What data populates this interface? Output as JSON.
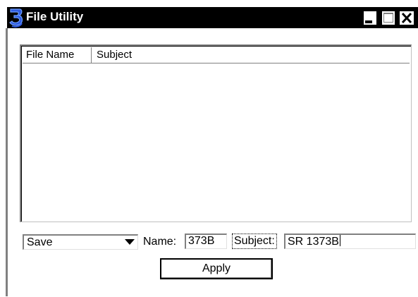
{
  "window": {
    "title": "File Utility",
    "icon": "bentley-b-icon",
    "controls": {
      "minimize": "minimize-icon",
      "maximize": "maximize-icon",
      "close": "close-icon"
    }
  },
  "list": {
    "columns": [
      "File Name",
      "Subject"
    ],
    "rows": []
  },
  "form": {
    "action": {
      "selected": "Save"
    },
    "name_label": "Name:",
    "name_value": "373B",
    "subject_label": "Subject:",
    "subject_value": "SR 1373B",
    "apply_label": "Apply"
  },
  "colors": {
    "titlebar": "#000000",
    "background": "#ffffff",
    "icon_blue": "#1a3ccc"
  }
}
